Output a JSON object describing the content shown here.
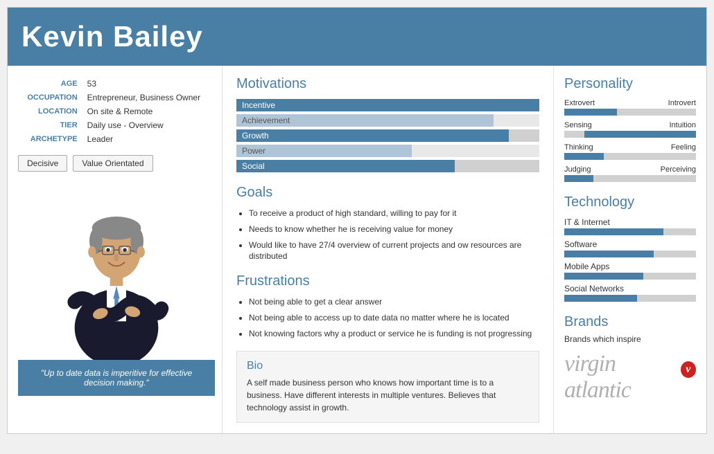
{
  "header": {
    "name": "Kevin Bailey"
  },
  "left": {
    "age_label": "AGE",
    "age_value": "53",
    "occupation_label": "OCCUPATION",
    "occupation_value": "Entrepreneur, Business Owner",
    "location_label": "LOCATION",
    "location_value": "On site & Remote",
    "tier_label": "TIER",
    "tier_value": "Daily use - Overview",
    "archetype_label": "ARCHETYPE",
    "archetype_value": "Leader",
    "tags": [
      "Decisive",
      "Value Orientated"
    ],
    "quote": "\"Up to date data is imperitive for effective decision making.\""
  },
  "motivations": {
    "title": "Motivations",
    "bars": [
      {
        "label": "Incentive",
        "pct": 100,
        "highlighted": true
      },
      {
        "label": "Achievement",
        "pct": 85,
        "highlighted": false
      },
      {
        "label": "Growth",
        "pct": 90,
        "highlighted": true
      },
      {
        "label": "Power",
        "pct": 58,
        "highlighted": false
      },
      {
        "label": "Social",
        "pct": 72,
        "highlighted": true
      }
    ]
  },
  "goals": {
    "title": "Goals",
    "items": [
      "To receive a product of high standard, willing to pay for it",
      "Needs to know whether he is receiving value for money",
      "Would like to have 27/4 overview of current projects and ow resources are distributed"
    ]
  },
  "frustrations": {
    "title": "Frustrations",
    "items": [
      "Not being able to get a clear answer",
      "Not being able to access up to date data no matter where he is located",
      "Not knowing factors why a product or service he is funding is not progressing"
    ]
  },
  "bio": {
    "title": "Bio",
    "text": "A self made business person who knows how important time is to a business. Have different interests in multiple ventures. Believes that technology assist in growth."
  },
  "personality": {
    "title": "Personality",
    "traits": [
      {
        "left": "Extrovert",
        "right": "Introvert",
        "fill_side": "left",
        "fill_pct": 40
      },
      {
        "left": "Sensing",
        "right": "Intuition",
        "fill_side": "right",
        "fill_pct": 85
      },
      {
        "left": "Thinking",
        "right": "Feeling",
        "fill_side": "left",
        "fill_pct": 30
      },
      {
        "left": "Judging",
        "right": "Perceiving",
        "fill_side": "left",
        "fill_pct": 22
      }
    ]
  },
  "technology": {
    "title": "Technology",
    "items": [
      {
        "label": "IT & Internet",
        "pct": 75
      },
      {
        "label": "Software",
        "pct": 68
      },
      {
        "label": "Mobile Apps",
        "pct": 60
      },
      {
        "label": "Social Networks",
        "pct": 55
      }
    ]
  },
  "brands": {
    "title": "Brands",
    "subtitle": "Brands which inspire",
    "logo_text": "virgin atlantic"
  }
}
